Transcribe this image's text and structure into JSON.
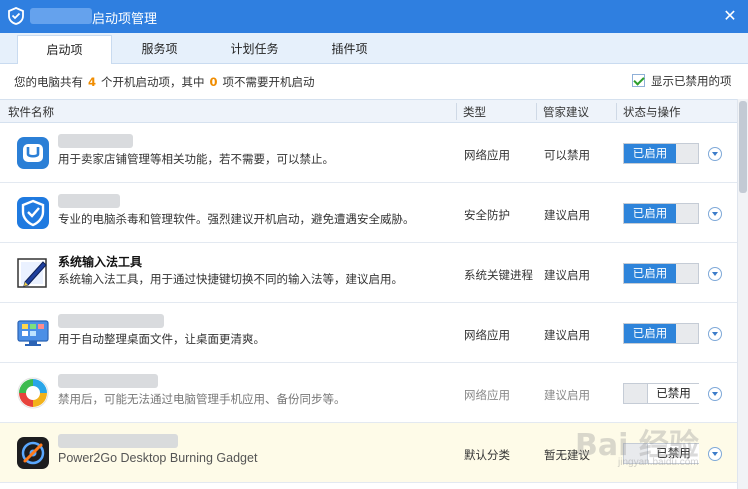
{
  "window": {
    "title": "启动项管理",
    "close_glyph": "✕"
  },
  "tabs": [
    {
      "label": "启动项",
      "active": true
    },
    {
      "label": "服务项",
      "active": false
    },
    {
      "label": "计划任务",
      "active": false
    },
    {
      "label": "插件项",
      "active": false
    }
  ],
  "summary": {
    "prefix": "您的电脑共有",
    "total": "4",
    "mid": "个开机启动项，其中",
    "unneeded": "0",
    "suffix": "项不需要开机启动",
    "show_disabled_label": "显示已禁用的项",
    "show_disabled_checked": true
  },
  "columns": {
    "name": "软件名称",
    "type": "类型",
    "advice": "管家建议",
    "status": "状态与操作"
  },
  "rows": [
    {
      "icon": "shop-u-icon",
      "name": "",
      "desc": "用于卖家店铺管理等相关功能，若不需要，可以禁止。",
      "type": "网络应用",
      "advice": "可以禁用",
      "status": "已启用",
      "enabled": true
    },
    {
      "icon": "shield-icon",
      "name": "",
      "desc": "专业的电脑杀毒和管理软件。强烈建议开机启动，避免遭遇安全威胁。",
      "type": "安全防护",
      "advice": "建议启用",
      "status": "已启用",
      "enabled": true
    },
    {
      "icon": "ime-pen-icon",
      "name": "系统输入法工具",
      "desc": "系统输入法工具，用于通过快捷键切换不同的输入法等，建议启用。",
      "type": "系统关键进程",
      "advice": "建议启用",
      "status": "已启用",
      "enabled": true
    },
    {
      "icon": "desktop-organizer-icon",
      "name": "",
      "desc": "用于自动整理桌面文件，让桌面更清爽。",
      "type": "网络应用",
      "advice": "建议启用",
      "status": "已启用",
      "enabled": true
    },
    {
      "icon": "phone-sync-icon",
      "name": "",
      "desc": "禁用后，可能无法通过电脑管理手机应用、备份同步等。",
      "type": "网络应用",
      "advice": "建议启用",
      "status": "已禁用",
      "enabled": false
    },
    {
      "icon": "power2go-icon",
      "name": "",
      "desc": "Power2Go Desktop Burning Gadget",
      "type": "默认分类",
      "advice": "暂无建议",
      "status": "已禁用",
      "enabled": false
    }
  ],
  "watermark": {
    "main": "Bai 经验",
    "sub": "jingyan.baidu.com"
  },
  "colors": {
    "accent": "#2e84da",
    "titlebar": "#2f7fe0",
    "highlight_row": "#fefbe8",
    "count_orange": "#f08c00"
  }
}
